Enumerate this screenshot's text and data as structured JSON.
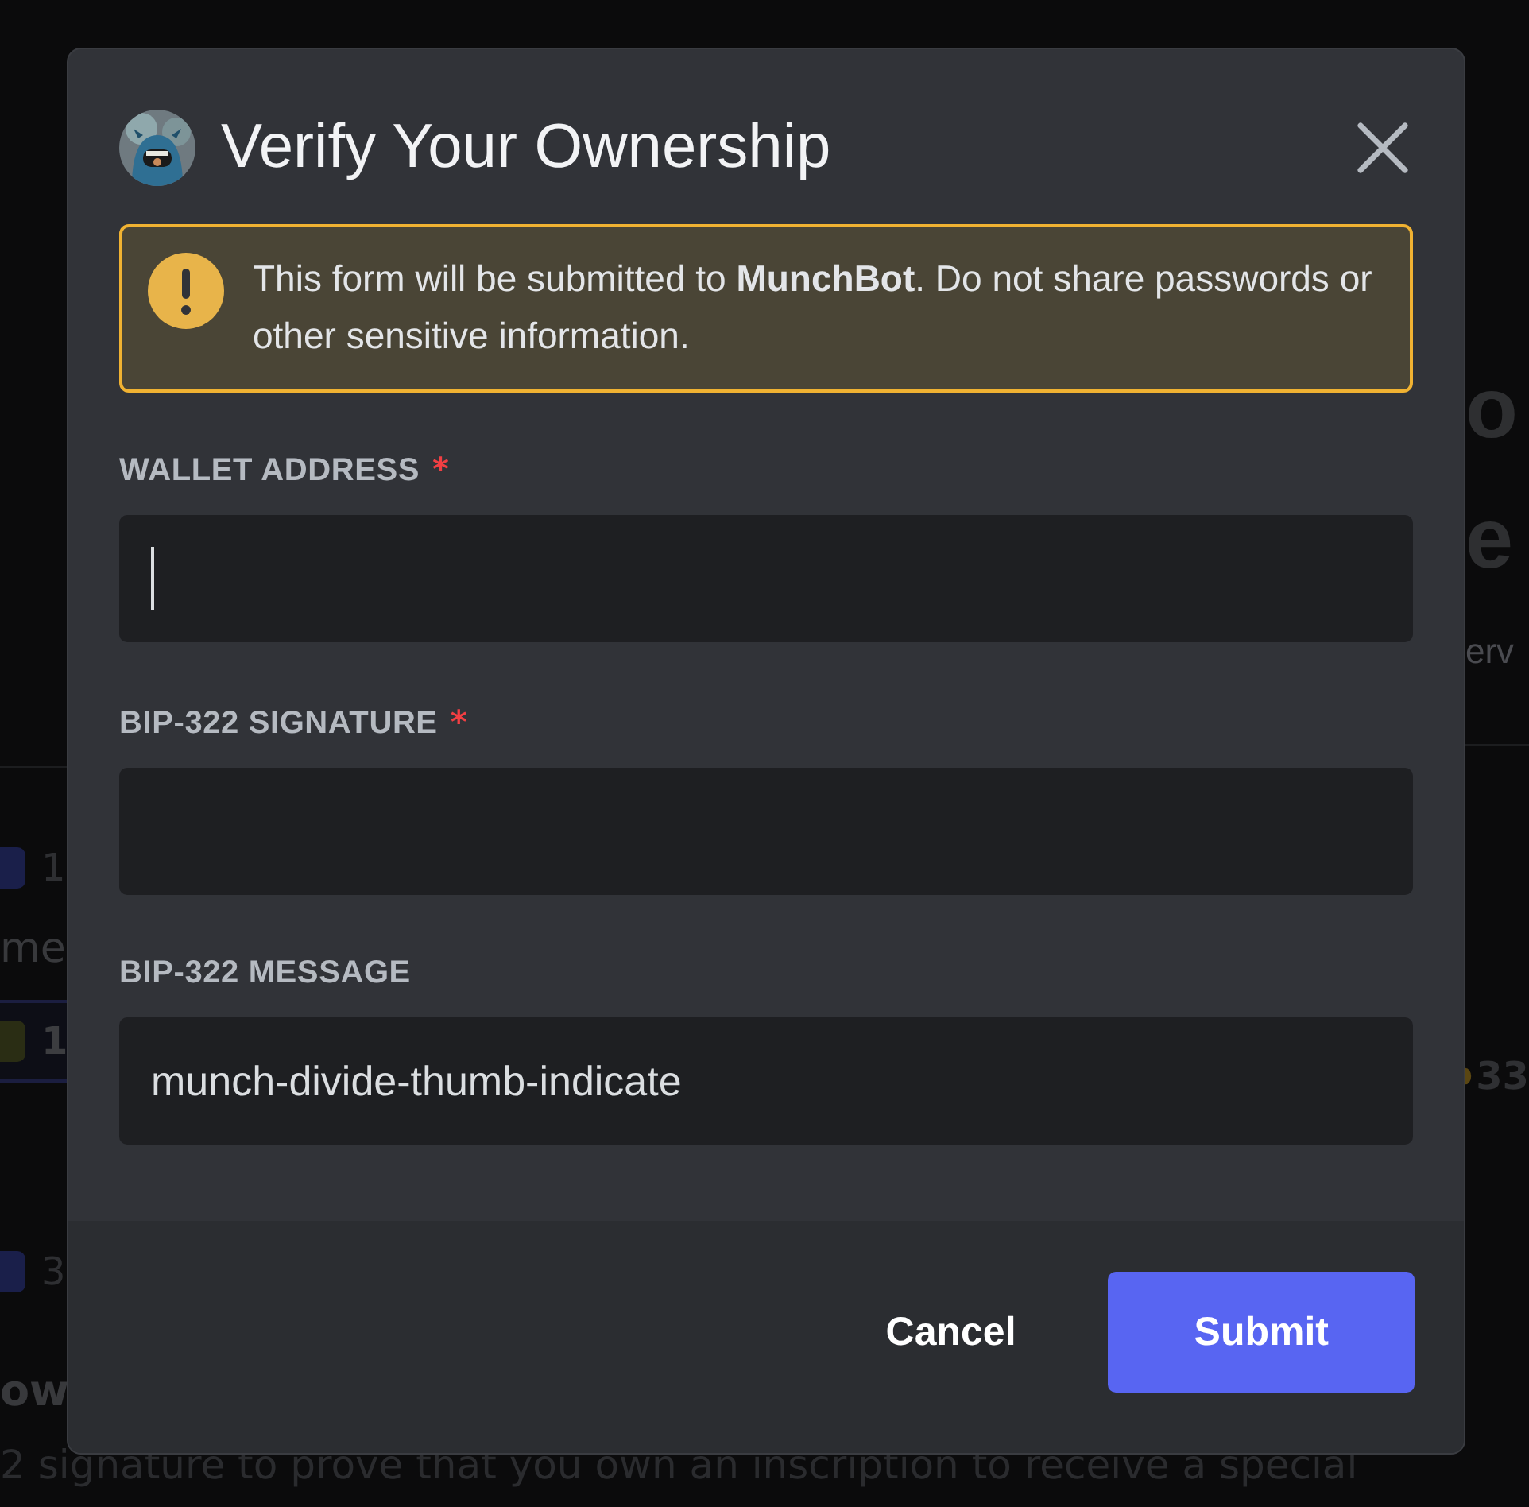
{
  "backdrop": {
    "left": [
      {
        "kind": "tag",
        "color": "#1a1f4a",
        "text": "1"
      },
      {
        "kind": "text",
        "text": "me"
      },
      {
        "kind": "highlight",
        "color": "#2a2d14",
        "text": "1"
      },
      {
        "kind": "tag",
        "color": "#1a1f4a",
        "text": "3"
      },
      {
        "kind": "heading",
        "text": "ow"
      }
    ],
    "right": [
      {
        "kind": "big",
        "text": "o"
      },
      {
        "kind": "big",
        "text": "e"
      },
      {
        "kind": "text",
        "text": "erv"
      },
      {
        "kind": "coin",
        "text": "33"
      }
    ],
    "bottom_text": "2 signature to prove that you own an inscription to receive a special"
  },
  "dialog": {
    "title": "Verify Your Ownership",
    "notice": "This form will be submitted to **MunchBot**. Do not share passwords or other sensitive information.",
    "fields": [
      {
        "label": "WALLET ADDRESS",
        "required_mark": "*",
        "focused": true
      },
      {
        "label": "BIP-322 SIGNATURE",
        "required_mark": "*",
        "focused": false
      },
      {
        "label": "BIP-322 MESSAGE",
        "value": "munch-divide-thumb-indicate",
        "focused": false
      }
    ],
    "buttons": [
      {
        "label": "Cancel",
        "kind": "link"
      },
      {
        "label": "Submit",
        "kind": "primary"
      }
    ]
  }
}
